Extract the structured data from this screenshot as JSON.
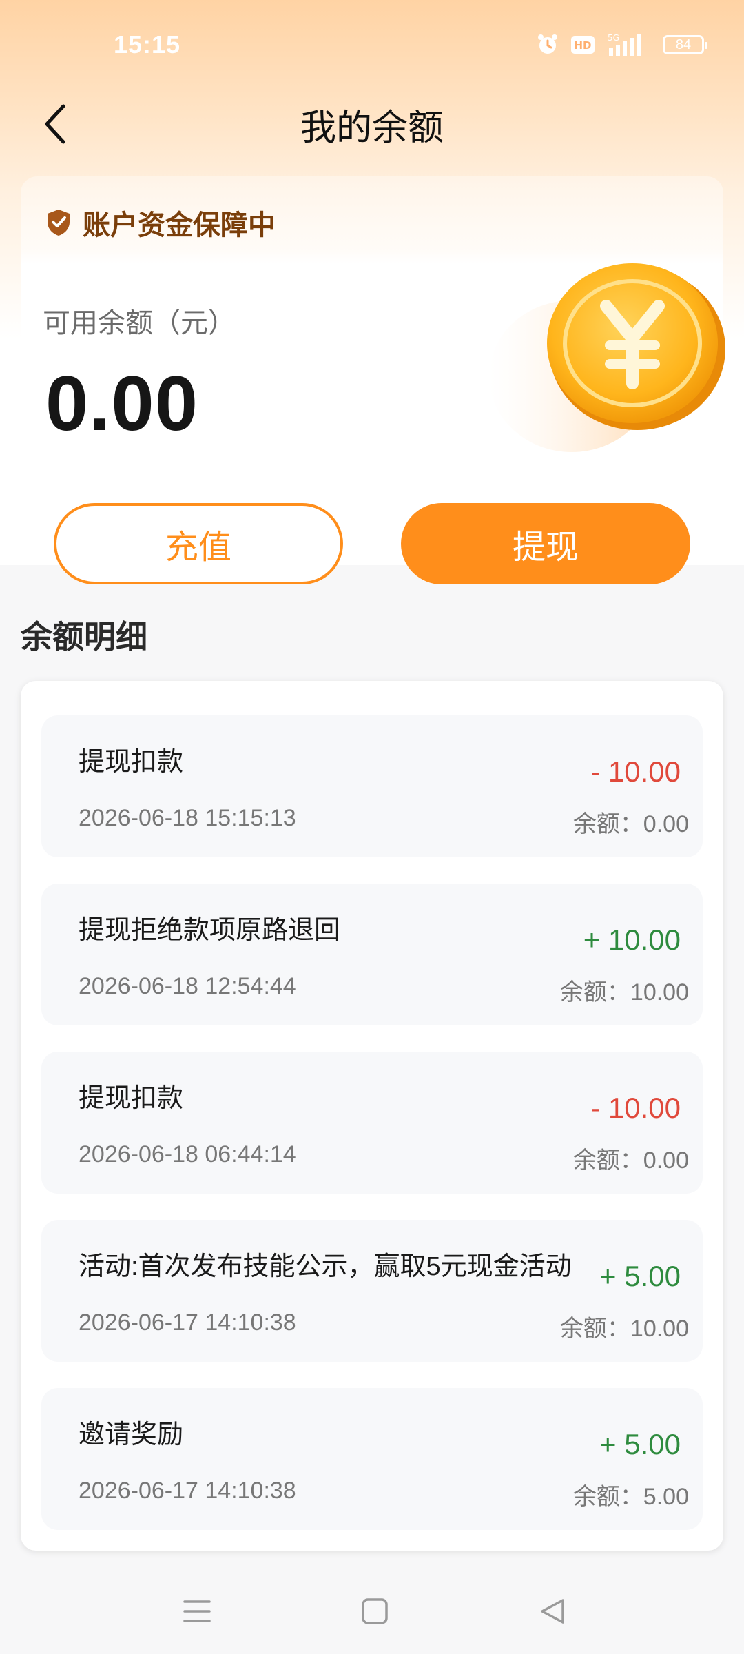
{
  "status_bar": {
    "time": "15:15",
    "battery": "84",
    "icons": [
      "alarm-icon",
      "hd-icon",
      "signal-5g-icon"
    ]
  },
  "nav": {
    "title": "我的余额",
    "back_icon": "chevron-left-icon"
  },
  "balance_card": {
    "protect_label": "账户资金保障中",
    "balance_label": "可用余额（元）",
    "balance_amount": "0.00"
  },
  "actions": {
    "recharge_label": "充值",
    "withdraw_label": "提现"
  },
  "details": {
    "section_title": "余额明细",
    "records": [
      {
        "title": "提现扣款",
        "amount": "- 10.00",
        "type": "negative",
        "date": "2026-06-18 15:15:13",
        "balance": "余额：0.00"
      },
      {
        "title": "提现拒绝款项原路退回",
        "amount": "+ 10.00",
        "type": "positive",
        "date": "2026-06-18 12:54:44",
        "balance": "余额：10.00"
      },
      {
        "title": "提现扣款",
        "amount": "- 10.00",
        "type": "negative",
        "date": "2026-06-18 06:44:14",
        "balance": "余额：0.00"
      },
      {
        "title": "活动:首次发布技能公示，赢取5元现金活动",
        "amount": "+ 5.00",
        "type": "positive",
        "date": "2026-06-17 14:10:38",
        "balance": "余额：10.00"
      },
      {
        "title": "邀请奖励",
        "amount": "+ 5.00",
        "type": "positive",
        "date": "2026-06-17 14:10:38",
        "balance": "余额：5.00"
      }
    ]
  },
  "colors": {
    "accent": "#ff8e1b",
    "negative": "#e0493b",
    "positive": "#2e8b3e",
    "protect_text": "#7a3e0a"
  },
  "system_nav": [
    "menu-icon",
    "home-square-icon",
    "back-triangle-icon"
  ]
}
